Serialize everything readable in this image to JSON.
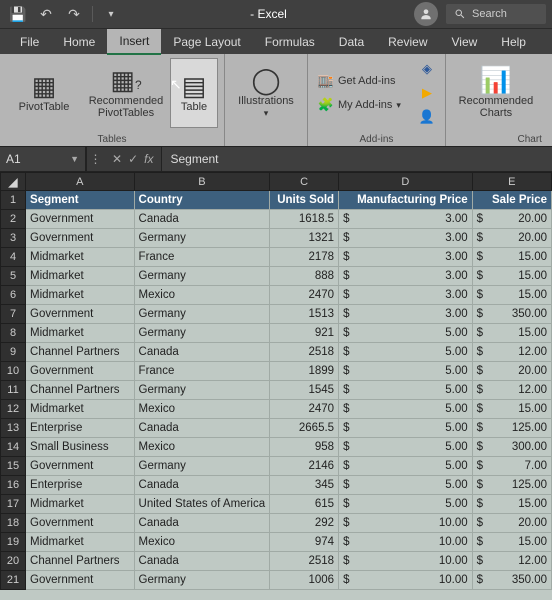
{
  "title": "- Excel",
  "search_placeholder": "Search",
  "tabs": [
    "File",
    "Home",
    "Insert",
    "Page Layout",
    "Formulas",
    "Data",
    "Review",
    "View",
    "Help"
  ],
  "active_tab": "Insert",
  "ribbon": {
    "tables_label": "Tables",
    "pivot": "PivotTable",
    "rec_pivot": "Recommended\nPivotTables",
    "table": "Table",
    "illustrations": "Illustrations",
    "addins": {
      "get": "Get Add-ins",
      "my": "My Add-ins",
      "group": "Add-ins"
    },
    "charts": {
      "rec": "Recommended\nCharts",
      "group": "Chart"
    }
  },
  "namebox": "A1",
  "formula": "Segment",
  "columns": [
    "A",
    "B",
    "C",
    "D",
    "E"
  ],
  "headers": [
    "Segment",
    "Country",
    "Units Sold",
    "Manufacturing Price",
    "Sale Price"
  ],
  "rows": [
    {
      "n": 1,
      "segment": "Government",
      "country": "Canada",
      "units": "1618.5",
      "mprice": "3.00",
      "sprice": "20.00"
    },
    {
      "n": 2,
      "segment": "Government",
      "country": "Germany",
      "units": "1321",
      "mprice": "3.00",
      "sprice": "20.00"
    },
    {
      "n": 3,
      "segment": "Midmarket",
      "country": "France",
      "units": "2178",
      "mprice": "3.00",
      "sprice": "15.00"
    },
    {
      "n": 4,
      "segment": "Midmarket",
      "country": "Germany",
      "units": "888",
      "mprice": "3.00",
      "sprice": "15.00"
    },
    {
      "n": 5,
      "segment": "Midmarket",
      "country": "Mexico",
      "units": "2470",
      "mprice": "3.00",
      "sprice": "15.00"
    },
    {
      "n": 6,
      "segment": "Government",
      "country": "Germany",
      "units": "1513",
      "mprice": "3.00",
      "sprice": "350.00"
    },
    {
      "n": 7,
      "segment": "Midmarket",
      "country": "Germany",
      "units": "921",
      "mprice": "5.00",
      "sprice": "15.00"
    },
    {
      "n": 8,
      "segment": "Channel Partners",
      "country": "Canada",
      "units": "2518",
      "mprice": "5.00",
      "sprice": "12.00"
    },
    {
      "n": 9,
      "segment": "Government",
      "country": "France",
      "units": "1899",
      "mprice": "5.00",
      "sprice": "20.00"
    },
    {
      "n": 10,
      "segment": "Channel Partners",
      "country": "Germany",
      "units": "1545",
      "mprice": "5.00",
      "sprice": "12.00"
    },
    {
      "n": 11,
      "segment": "Midmarket",
      "country": "Mexico",
      "units": "2470",
      "mprice": "5.00",
      "sprice": "15.00"
    },
    {
      "n": 12,
      "segment": "Enterprise",
      "country": "Canada",
      "units": "2665.5",
      "mprice": "5.00",
      "sprice": "125.00"
    },
    {
      "n": 13,
      "segment": "Small Business",
      "country": "Mexico",
      "units": "958",
      "mprice": "5.00",
      "sprice": "300.00"
    },
    {
      "n": 14,
      "segment": "Government",
      "country": "Germany",
      "units": "2146",
      "mprice": "5.00",
      "sprice": "7.00"
    },
    {
      "n": 15,
      "segment": "Enterprise",
      "country": "Canada",
      "units": "345",
      "mprice": "5.00",
      "sprice": "125.00"
    },
    {
      "n": 16,
      "segment": "Midmarket",
      "country": "United States of America",
      "units": "615",
      "mprice": "5.00",
      "sprice": "15.00"
    },
    {
      "n": 17,
      "segment": "Government",
      "country": "Canada",
      "units": "292",
      "mprice": "10.00",
      "sprice": "20.00"
    },
    {
      "n": 18,
      "segment": "Midmarket",
      "country": "Mexico",
      "units": "974",
      "mprice": "10.00",
      "sprice": "15.00"
    },
    {
      "n": 19,
      "segment": "Channel Partners",
      "country": "Canada",
      "units": "2518",
      "mprice": "10.00",
      "sprice": "12.00"
    },
    {
      "n": 20,
      "segment": "Government",
      "country": "Germany",
      "units": "1006",
      "mprice": "10.00",
      "sprice": "350.00"
    }
  ],
  "currency": "$"
}
